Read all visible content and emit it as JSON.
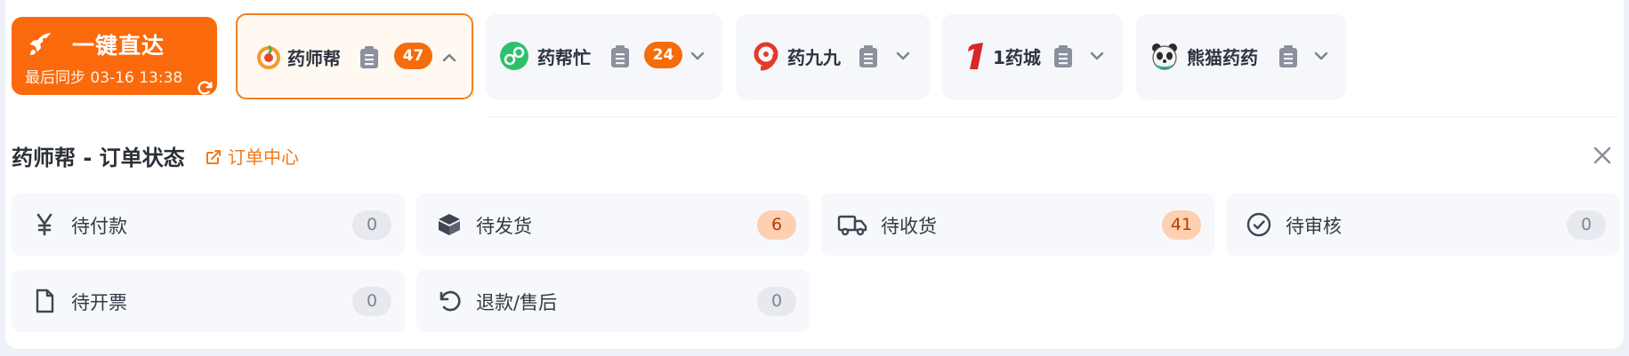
{
  "quick_access": {
    "title": "一键直达",
    "sync_text": "最后同步 03-16 13:38",
    "rocket_icon": "rocket-icon",
    "refresh_icon": "refresh-icon",
    "color": "#fa6a0c"
  },
  "platforms": [
    {
      "name": "药师帮",
      "badge": "47",
      "active": true,
      "logo": "yaoshibang-logo",
      "chevron": "chevron-up-icon"
    },
    {
      "name": "药帮忙",
      "badge": "24",
      "active": false,
      "logo": "yaobangmang-logo",
      "chevron": "chevron-down-icon"
    },
    {
      "name": "药九九",
      "badge": "",
      "active": false,
      "logo": "yaojiujiu-logo",
      "chevron": "chevron-down-icon"
    },
    {
      "name": "1药城",
      "badge": "",
      "active": false,
      "logo": "1yaocheng-logo",
      "chevron": "chevron-down-icon"
    },
    {
      "name": "熊猫药药",
      "badge": "",
      "active": false,
      "logo": "panda-logo",
      "chevron": "chevron-down-icon"
    }
  ],
  "section": {
    "title": "药师帮 - 订单状态",
    "link_label": "订单中心",
    "link_icon": "external-link-icon",
    "close_icon": "close-icon"
  },
  "order_status": [
    {
      "label": "待付款",
      "count": "0",
      "icon": "yen-icon",
      "highlight": false
    },
    {
      "label": "待发货",
      "count": "6",
      "icon": "box-icon",
      "highlight": true
    },
    {
      "label": "待收货",
      "count": "41",
      "icon": "truck-icon",
      "highlight": true
    },
    {
      "label": "待审核",
      "count": "0",
      "icon": "check-circle-icon",
      "highlight": false
    },
    {
      "label": "待开票",
      "count": "0",
      "icon": "document-icon",
      "highlight": false
    },
    {
      "label": "退款/售后",
      "count": "0",
      "icon": "undo-icon",
      "highlight": false
    }
  ],
  "colors": {
    "accent": "#f56c0b",
    "active_border": "#f2801e",
    "badge_hot_bg": "#fcd0b0",
    "badge_hot_text": "#b83c08"
  }
}
